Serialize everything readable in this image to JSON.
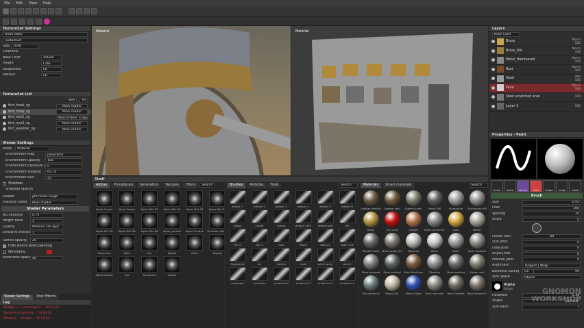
{
  "menu": [
    "File",
    "Edit",
    "View",
    "Help"
  ],
  "textureset_settings": {
    "title": "TextureSet Settings",
    "undo_stack": "Undo stack",
    "texture_set": "TextureSet",
    "size_label": "Size",
    "size_value": "2048",
    "channels": "Channels",
    "rows": [
      {
        "label": "Base Color",
        "value": "sRGB8"
      },
      {
        "label": "Height",
        "value": "L16F"
      },
      {
        "label": "Roughness",
        "value": "L8"
      },
      {
        "label": "Metallic",
        "value": "L8"
      }
    ]
  },
  "textureset_list": {
    "title": "TextureSet List",
    "solo": "Solo",
    "all": "All",
    "items": [
      {
        "name": "bird_beak_sg",
        "shader": "Main shader"
      },
      {
        "name": "bird_body_sg",
        "shader": "Main shader"
      },
      {
        "name": "bird_eye1_sg",
        "shader": "Main shader (Copy)"
      },
      {
        "name": "bird_eye2_sg",
        "shader": "Main shader"
      },
      {
        "name": "bird_eyeliner_sg",
        "shader": "Main shader"
      }
    ]
  },
  "viewer_settings": {
    "title": "Viewer Settings",
    "mode_label": "Mode",
    "mode_value": "Material",
    "rows": [
      {
        "label": "Environment Map",
        "value": "panorama"
      },
      {
        "label": "Environment Opacity",
        "value": "100"
      },
      {
        "label": "Environment Exposure (EV)",
        "value": "0"
      },
      {
        "label": "Environment Rotation",
        "value": "65.74"
      },
      {
        "label": "Environment Blur",
        "value": "25"
      }
    ],
    "shadows": "Shadows",
    "shadows_opacity": "Shadows opacity",
    "shader_label": "Shader",
    "shader_value": "pbr-metal-rough",
    "instance_label": "Instance name",
    "instance_value": "Main shader",
    "params_header": "Shader Parameters",
    "params": [
      {
        "label": "AO Intensity",
        "value": "0.75"
      },
      {
        "label": "Height force",
        "value": "1"
      },
      {
        "label": "Quality",
        "value": "Medium (16 spp)"
      },
      {
        "label": "Emissive Intensity",
        "value": "1"
      }
    ],
    "stencil_opacity_label": "Stencil opacity",
    "stencil_opacity_value": "25",
    "hide_stencil": "Hide stencil when painting",
    "wireframe": "Wireframe",
    "wireframe_opacity_label": "Wireframe opacity",
    "wireframe_opacity_value": "40",
    "wire_color": "#c0201f"
  },
  "bottom_tabs": [
    "Viewer Settings",
    "Post Effects"
  ],
  "log": {
    "title": "Log",
    "lines": [
      "[Bridge] [...] scanning for ... 16:14:20 ...",
      "[Texture] converting ... 16:14:21 ...",
      "[Texture] ... shader ... 16:14:22 ..."
    ]
  },
  "viewports": {
    "left_label": "Material",
    "right_label": "Material"
  },
  "shelf": {
    "title": "Shelf",
    "alpha_tabs": [
      "Alphas",
      "Procedurals",
      "Generators",
      "Textures",
      "Filters"
    ],
    "alpha_search": "Search",
    "alphas": [
      "Alpha Cracks",
      "Alpha Cracks",
      "Alpha Dirt 01",
      "Alpha Dirt 02",
      "Alpha Dirt 03",
      "Alpha Dirt 04",
      "Alpha Dirt 05",
      "Alpha Dirt 06",
      "Alpha Dirt 08",
      "alpha_scratch",
      "Alpha Scratch",
      "Gaussian Noise",
      "Sharp line",
      "Mold",
      "Fan",
      "Splash",
      "Dash",
      "Zigzag",
      "Alpha Details",
      "Jets",
      "Scratches",
      "Shape"
    ],
    "brush_tabs": [
      "Brushes",
      "Particles",
      "Tools"
    ],
    "brush_search": "Search",
    "brushes": [
      "artistic 1",
      "artistic 2",
      "artistic 3",
      "artistic 4",
      "artistic 5",
      "artistic 6",
      "cotton",
      "cracks",
      "mortar",
      "default hard",
      "default soft",
      "dirt",
      "dirt 2",
      "dirt 3",
      "dust",
      "fibers",
      "fibers 2",
      "fibers line",
      "fingerprint",
      "fur",
      "leather",
      "mold",
      "paint spray",
      "pencil",
      "cardpaper",
      "scratches",
      "scratches 2",
      "scratches 3",
      "scratches 4",
      "scratches 5"
    ],
    "material_tabs": [
      "Materials",
      "Smart materials"
    ],
    "material_search": "Search",
    "materials": [
      {
        "name": "Leather interior",
        "color": "#6b5a45"
      },
      {
        "name": "Leather skin",
        "color": "#6e5a3e"
      },
      {
        "name": "Lizard scales",
        "color": "#7d7a6a"
      },
      {
        "name": "Metal 008",
        "color": "#5e5e5c"
      },
      {
        "name": "Aluminium",
        "color": "#9a9a98"
      },
      {
        "name": "Aluminium Infl",
        "color": "#8e8e8c"
      },
      {
        "name": "Brass",
        "color": "#b09040"
      },
      {
        "name": "Car paint",
        "color": "#c01010"
      },
      {
        "name": "Copper",
        "color": "#b0704a"
      },
      {
        "name": "Metal Aluminium",
        "color": "#888"
      },
      {
        "name": "Gold",
        "color": "#d0a640"
      },
      {
        "name": "Nickel",
        "color": "#a8a49c"
      },
      {
        "name": "Painted steel",
        "color": "#6a6866"
      },
      {
        "name": "Metal plate 011",
        "color": "#7a7670"
      },
      {
        "name": "Platinum",
        "color": "#bdbab4"
      },
      {
        "name": "Silver",
        "color": "#c8c8c8"
      },
      {
        "name": "Steel",
        "color": "#9a9a9a"
      },
      {
        "name": "Steel brushed",
        "color": "#8c8a86"
      },
      {
        "name": "Steel bumped",
        "color": "#7d7c78"
      },
      {
        "name": "Steel painted",
        "color": "#5b6260"
      },
      {
        "name": "Steel Rust Iron",
        "color": "#7a5a40"
      },
      {
        "name": "Titanium",
        "color": "#8e8e92"
      },
      {
        "name": "Metal welding",
        "color": "#6a6a6a"
      },
      {
        "name": "Mortar wall",
        "color": "#7f7b70"
      },
      {
        "name": "Old painted pl",
        "color": "#6a7a7a"
      },
      {
        "name": "Paper 005",
        "color": "#c0b8a0"
      },
      {
        "name": "Plastic Base",
        "color": "#3050b0"
      },
      {
        "name": "Rock concrete",
        "color": "#8a8680"
      },
      {
        "name": "Rock Faceted",
        "color": "#6e6a62"
      },
      {
        "name": "Rock Faceted 2",
        "color": "#7a7268"
      }
    ]
  },
  "layers": {
    "title": "Layers",
    "channel": "Base Color",
    "items": [
      {
        "name": "Brass",
        "blend": "Norm",
        "value": "100",
        "thumb": "#c8a64a"
      },
      {
        "name": "Brass_Old",
        "blend": "Norm",
        "value": "100",
        "thumb": "#9a8040"
      },
      {
        "name": "Metal_Hammered",
        "blend": "Norm",
        "value": "100",
        "thumb": "#888"
      },
      {
        "name": "Rust",
        "blend": "Norm",
        "value": "100",
        "thumb": "#7a4a2a"
      },
      {
        "name": "Steel",
        "blend": "Mul",
        "value": "100",
        "thumb": "#999"
      },
      {
        "name": "Paint",
        "blend": "Norm",
        "value": "100",
        "thumb": "#d0d0d0"
      },
      {
        "name": "Steel scratched scan",
        "blend": "",
        "value": "100",
        "thumb": "#777"
      },
      {
        "name": "Layer 1",
        "blend": "",
        "value": "100",
        "thumb": "#666"
      }
    ]
  },
  "properties": {
    "title": "Properties - Paint",
    "channel_chips": [
      "brush",
      "alpha",
      "stencil",
      "color",
      "height",
      "rough",
      "metal"
    ],
    "brush_header": "Brush",
    "rows": [
      {
        "label": "Size",
        "value": "0.92"
      },
      {
        "label": "Flow",
        "value": "100"
      },
      {
        "label": "Spacing",
        "value": "20"
      },
      {
        "label": "Angle",
        "value": "0"
      }
    ],
    "follow_path": "Follow Path",
    "follow_value": "Off",
    "jitters": [
      {
        "label": "Size Jitter",
        "value": "0"
      },
      {
        "label": "Flow Jitter",
        "value": "0"
      },
      {
        "label": "Angle Jitter",
        "value": "0"
      },
      {
        "label": "Position Jitter",
        "value": "0"
      }
    ],
    "alignment_label": "Alignment",
    "alignment_value": "Tangent | Wrap",
    "backface_label": "Backface culling",
    "backface_on": "On",
    "backface_value": "90",
    "sizespace_label": "Size Space",
    "sizespace_value": "Object",
    "alpha_header": "Alpha",
    "alpha_sub": "Shape",
    "alpha_rows": [
      {
        "label": "Hardness",
        "value": "0.38"
      },
      {
        "label": "Shape",
        "value": "Gaussian"
      },
      {
        "label": "Size Ratio",
        "value": "1"
      }
    ]
  },
  "watermark": [
    "GNOMON",
    "WORKSHOP"
  ]
}
